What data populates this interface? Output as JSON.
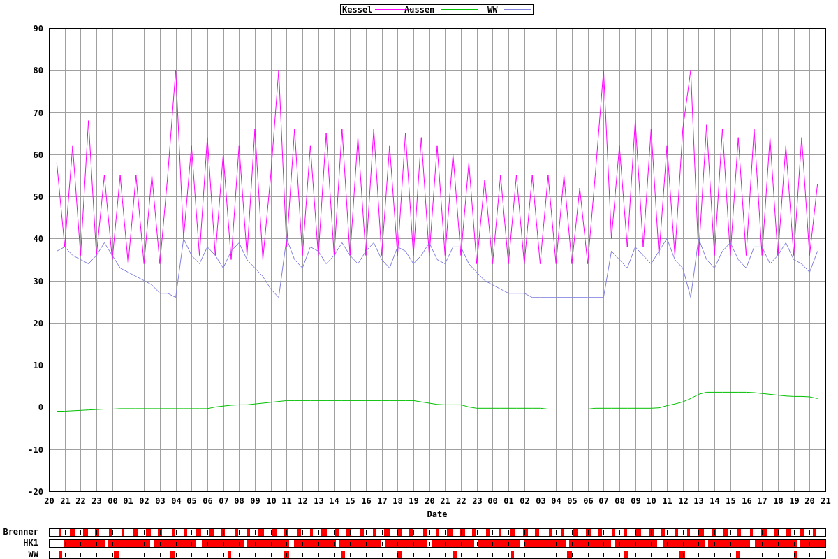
{
  "chart_data": {
    "type": "line",
    "xlabel": "Date",
    "categories": [
      "20",
      null,
      "21",
      null,
      "22",
      null,
      "23",
      null,
      "00",
      null,
      "01",
      null,
      "02",
      null,
      "03",
      null,
      "04",
      null,
      "05",
      null,
      "06",
      null,
      "07",
      null,
      "08",
      null,
      "09",
      null,
      "10",
      null,
      "11",
      null,
      "12",
      null,
      "13",
      null,
      "14",
      null,
      "15",
      null,
      "16",
      null,
      "17",
      null,
      "18",
      null,
      "19",
      null,
      "20",
      null,
      "21",
      null,
      "22",
      null,
      "23",
      null,
      "00",
      null,
      "01",
      null,
      "02",
      null,
      "03",
      null,
      "04",
      null,
      "05",
      null,
      "06",
      null,
      "07",
      null,
      "08",
      null,
      "09",
      null,
      "10",
      null,
      "11",
      null,
      "12",
      null,
      "13",
      null,
      "14",
      null,
      "15",
      null,
      "16",
      null,
      "17",
      null,
      "18",
      null,
      "19",
      null,
      "20",
      null,
      "21"
    ],
    "series": [
      {
        "name": "Kessel",
        "color": "#ff00ff",
        "values": [
          null,
          58,
          38,
          62,
          36,
          68,
          36,
          55,
          35,
          55,
          34,
          55,
          34,
          55,
          34,
          55,
          80,
          40,
          62,
          36,
          64,
          36,
          60,
          35,
          62,
          36,
          66,
          35,
          55,
          80,
          38,
          66,
          36,
          62,
          36,
          65,
          36,
          66,
          36,
          64,
          36,
          66,
          36,
          62,
          36,
          65,
          36,
          64,
          36,
          62,
          36,
          60,
          36,
          58,
          34,
          54,
          34,
          55,
          34,
          55,
          34,
          55,
          34,
          55,
          34,
          55,
          34,
          52,
          34,
          56,
          80,
          40,
          62,
          38,
          68,
          38,
          66,
          36,
          62,
          36,
          66,
          80,
          36,
          67,
          36,
          66,
          36,
          64,
          36,
          66,
          36,
          64,
          36,
          62,
          36,
          64,
          36,
          53,
          null
        ]
      },
      {
        "name": "Aussen",
        "color": "#00c000",
        "values": [
          null,
          -1,
          -1,
          -0.9,
          -0.8,
          -0.7,
          -0.6,
          -0.5,
          -0.5,
          -0.4,
          -0.4,
          -0.4,
          -0.4,
          -0.4,
          -0.4,
          -0.4,
          -0.4,
          -0.4,
          -0.4,
          -0.4,
          -0.4,
          0,
          0.2,
          0.4,
          0.5,
          0.5,
          0.7,
          0.9,
          1.1,
          1.3,
          1.5,
          1.5,
          1.5,
          1.5,
          1.5,
          1.5,
          1.5,
          1.5,
          1.5,
          1.5,
          1.5,
          1.5,
          1.5,
          1.5,
          1.5,
          1.5,
          1.5,
          1.2,
          0.9,
          0.6,
          0.5,
          0.5,
          0.5,
          0,
          -0.3,
          -0.3,
          -0.3,
          -0.3,
          -0.3,
          -0.3,
          -0.3,
          -0.3,
          -0.3,
          -0.5,
          -0.5,
          -0.5,
          -0.5,
          -0.5,
          -0.5,
          -0.3,
          -0.3,
          -0.3,
          -0.3,
          -0.3,
          -0.3,
          -0.3,
          -0.3,
          -0.2,
          0.3,
          0.7,
          1.2,
          2.0,
          3.0,
          3.5,
          3.5,
          3.5,
          3.5,
          3.5,
          3.5,
          3.4,
          3.2,
          3.0,
          2.8,
          2.6,
          2.5,
          2.5,
          2.4,
          2.0,
          null
        ]
      },
      {
        "name": "WW",
        "color": "#8080e0",
        "values": [
          null,
          37,
          38,
          36,
          35,
          34,
          36,
          39,
          36,
          33,
          32,
          31,
          30,
          29,
          27,
          27,
          26,
          40,
          36,
          34,
          38,
          36,
          33,
          37,
          39,
          35,
          33,
          31,
          28,
          26,
          40,
          35,
          33,
          38,
          37,
          34,
          36,
          39,
          36,
          34,
          37,
          39,
          35,
          33,
          38,
          37,
          34,
          36,
          39,
          35,
          34,
          38,
          38,
          34,
          32,
          30,
          29,
          28,
          27,
          27,
          27,
          26,
          26,
          26,
          26,
          26,
          26,
          26,
          26,
          26,
          26,
          37,
          35,
          33,
          38,
          36,
          34,
          37,
          40,
          35,
          33,
          26,
          40,
          35,
          33,
          37,
          39,
          35,
          33,
          38,
          38,
          34,
          36,
          39,
          35,
          34,
          32,
          37,
          null
        ]
      }
    ],
    "ylim": [
      -20,
      90
    ],
    "yticks": [
      -20,
      -10,
      0,
      10,
      20,
      30,
      40,
      50,
      60,
      70,
      80,
      90
    ],
    "grid": true,
    "legend": true
  },
  "state_bars": [
    {
      "label": "Brenner"
    },
    {
      "label": "HK1"
    },
    {
      "label": "WW"
    }
  ]
}
